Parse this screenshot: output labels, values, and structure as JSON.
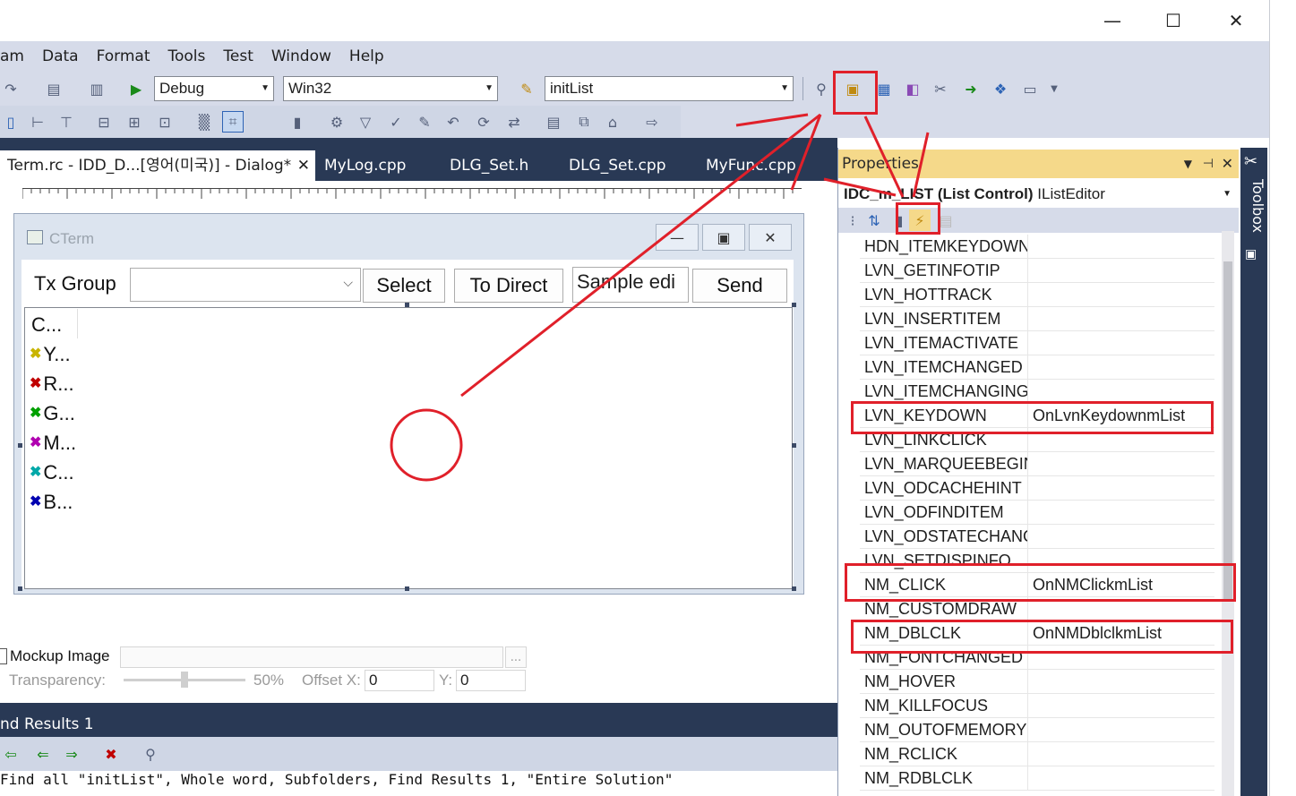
{
  "menu": {
    "items": [
      "am",
      "Data",
      "Format",
      "Tools",
      "Test",
      "Window",
      "Help"
    ]
  },
  "toolbar": {
    "config": "Debug",
    "platform": "Win32",
    "find_value": "initList"
  },
  "tabs": [
    {
      "label": "Term.rc - IDD_D...[영어(미국)] - Dialog*",
      "active": true,
      "close": "✕"
    },
    {
      "label": "MyLog.cpp"
    },
    {
      "label": "DLG_Set.h"
    },
    {
      "label": "DLG_Set.cpp"
    },
    {
      "label": "MyFunc.cpp"
    }
  ],
  "dialog": {
    "title": "CTerm",
    "tx_group_label": "Tx Group",
    "select_button": "Select",
    "to_direct_button": "To Direct",
    "sample_edit": "Sample edi",
    "send_button": "Send",
    "list_items": [
      {
        "text": "C...",
        "color": "#000000",
        "icon": ""
      },
      {
        "text": "Y...",
        "color": "#c8b400",
        "icon": "✖"
      },
      {
        "text": "R...",
        "color": "#c00000",
        "icon": "✖"
      },
      {
        "text": "G...",
        "color": "#00a000",
        "icon": "✖"
      },
      {
        "text": "M...",
        "color": "#b000b0",
        "icon": "✖"
      },
      {
        "text": "C...",
        "color": "#00a8a8",
        "icon": "✖"
      },
      {
        "text": "B...",
        "color": "#0000b0",
        "icon": "✖"
      }
    ]
  },
  "mockup": {
    "label": "Mockup Image",
    "browse": "...",
    "transparency_label": "Transparency:",
    "transparency_value": "50%",
    "offset_x_label": "Offset X:",
    "offset_x_value": "0",
    "offset_y_label": "Y:",
    "offset_y_value": "0"
  },
  "results": {
    "title": "nd Results 1",
    "line": "Find all \"initList\", Whole word, Subfolders, Find Results 1, \"Entire Solution\""
  },
  "properties": {
    "header": "Properties",
    "object_bold": "IDC_m_LIST (List Control)",
    "object_rest": " IListEditor",
    "rows": [
      {
        "name": "HDN_ITEMKEYDOWN",
        "value": ""
      },
      {
        "name": "LVN_GETINFOTIP",
        "value": ""
      },
      {
        "name": "LVN_HOTTRACK",
        "value": ""
      },
      {
        "name": "LVN_INSERTITEM",
        "value": ""
      },
      {
        "name": "LVN_ITEMACTIVATE",
        "value": ""
      },
      {
        "name": "LVN_ITEMCHANGED",
        "value": ""
      },
      {
        "name": "LVN_ITEMCHANGING",
        "value": ""
      },
      {
        "name": "LVN_KEYDOWN",
        "value": "OnLvnKeydownmList"
      },
      {
        "name": "LVN_LINKCLICK",
        "value": ""
      },
      {
        "name": "LVN_MARQUEEBEGIN",
        "value": ""
      },
      {
        "name": "LVN_ODCACHEHINT",
        "value": ""
      },
      {
        "name": "LVN_ODFINDITEM",
        "value": ""
      },
      {
        "name": "LVN_ODSTATECHANG",
        "value": ""
      },
      {
        "name": "LVN_SETDISPINFO",
        "value": ""
      },
      {
        "name": "NM_CLICK",
        "value": "OnNMClickmList"
      },
      {
        "name": "NM_CUSTOMDRAW",
        "value": ""
      },
      {
        "name": "NM_DBLCLK",
        "value": "OnNMDblclkmList"
      },
      {
        "name": "NM_FONTCHANGED",
        "value": ""
      },
      {
        "name": "NM_HOVER",
        "value": ""
      },
      {
        "name": "NM_KILLFOCUS",
        "value": ""
      },
      {
        "name": "NM_OUTOFMEMORY",
        "value": ""
      },
      {
        "name": "NM_RCLICK",
        "value": ""
      },
      {
        "name": "NM_RDBLCLK",
        "value": ""
      }
    ]
  },
  "toolbox": {
    "label": "Toolbox"
  },
  "colors": {
    "annotation": "#e0202a",
    "tab_bar": "#293955",
    "props_header": "#f5d98a"
  }
}
